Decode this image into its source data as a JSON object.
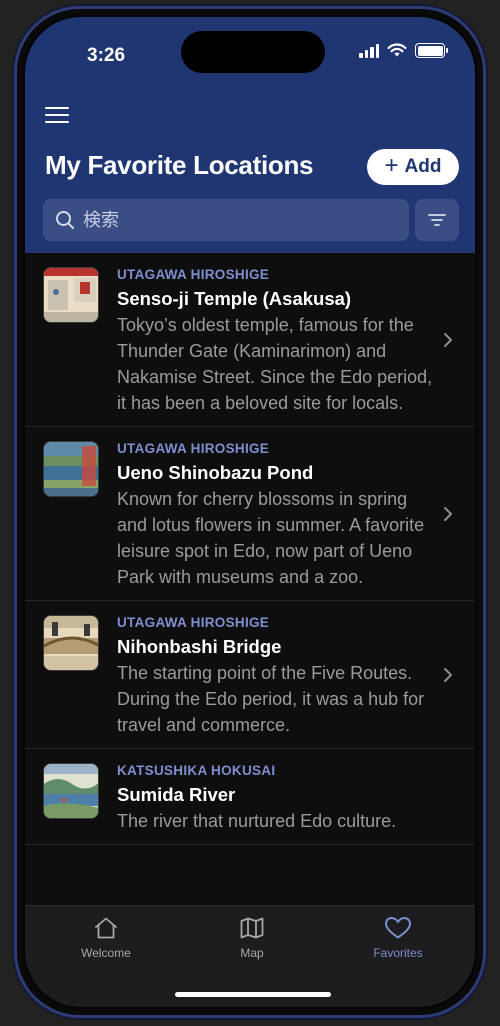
{
  "status_bar": {
    "time": "3:26"
  },
  "header": {
    "title": "My Favorite Locations",
    "add_label": "Add",
    "search_placeholder": "検索"
  },
  "locations": [
    {
      "artist": "UTAGAWA HIROSHIGE",
      "title": "Senso-ji Temple (Asakusa)",
      "description": "Tokyo’s oldest temple, famous for the Thunder Gate (Kaminarimon) and Nakamise Street. Since the Edo period, it has been a beloved site for locals."
    },
    {
      "artist": "UTAGAWA HIROSHIGE",
      "title": "Ueno Shinobazu Pond",
      "description": "Known for cherry blossoms in spring and lotus flowers in summer. A favorite leisure spot in Edo, now part of Ueno Park with museums and a zoo."
    },
    {
      "artist": "UTAGAWA HIROSHIGE",
      "title": "Nihonbashi Bridge",
      "description": "The starting point of the Five Routes. During the Edo period, it was a hub for travel and commerce."
    },
    {
      "artist": "KATSUSHIKA HOKUSAI",
      "title": "Sumida River",
      "description": "The river that nurtured Edo culture."
    }
  ],
  "tabs": [
    {
      "label": "Welcome",
      "icon": "home-icon"
    },
    {
      "label": "Map",
      "icon": "map-icon"
    },
    {
      "label": "Favorites",
      "icon": "heart-icon",
      "active": true
    }
  ],
  "colors": {
    "header_bg": "#1f3672",
    "accent": "#7f8fcf",
    "background": "#0e0e0f"
  }
}
